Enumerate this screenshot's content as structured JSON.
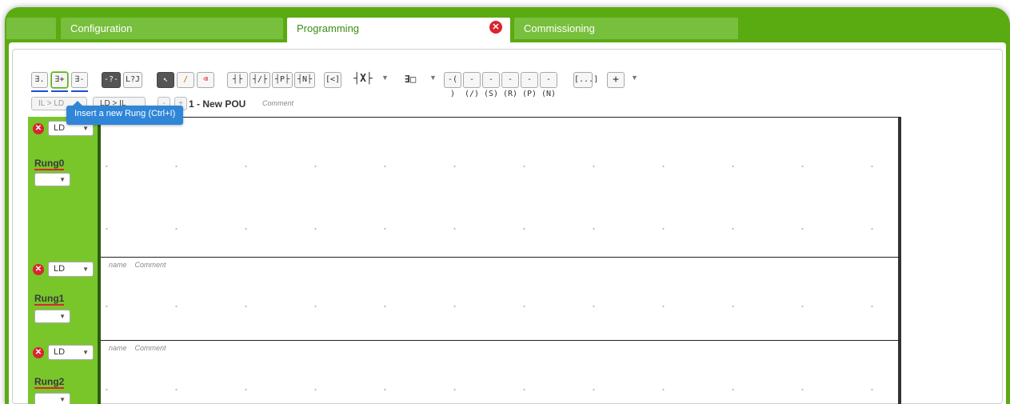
{
  "tabs": [
    {
      "label": "",
      "active": false
    },
    {
      "label": "Configuration",
      "active": false
    },
    {
      "label": "Programming",
      "active": true
    },
    {
      "label": "Commissioning",
      "active": false
    }
  ],
  "colors": {
    "accent": "#5aaa12",
    "active_tab_text": "#3b8c14",
    "close_red": "#d9252f",
    "tooltip": "#2f86d8"
  },
  "toolbar": {
    "buttons": [
      {
        "name": "insert-rung-before",
        "glyph": "∃."
      },
      {
        "name": "insert-rung-after",
        "glyph": "∃+"
      },
      {
        "name": "delete-rung",
        "glyph": "∃-"
      },
      {
        "name": "dark-left",
        "glyph": "-?-"
      },
      {
        "name": "branch",
        "glyph": "L?J"
      },
      {
        "name": "select",
        "glyph": "↖"
      },
      {
        "name": "draw",
        "glyph": "/"
      },
      {
        "name": "erase",
        "glyph": "⌫"
      },
      {
        "name": "contact-no",
        "glyph": "┤├"
      },
      {
        "name": "contact-nc",
        "glyph": "┤/├"
      },
      {
        "name": "contact-p",
        "glyph": "┤P├"
      },
      {
        "name": "contact-n",
        "glyph": "┤N├"
      },
      {
        "name": "compare",
        "glyph": "[<]"
      },
      {
        "name": "function-block",
        "glyph": "┤X├"
      },
      {
        "name": "block",
        "glyph": "∃□"
      },
      {
        "name": "coil",
        "glyph": "-( )"
      },
      {
        "name": "coil-not",
        "glyph": "-(/)"
      },
      {
        "name": "coil-set",
        "glyph": "-(S)"
      },
      {
        "name": "coil-reset",
        "glyph": "-(R)"
      },
      {
        "name": "coil-p",
        "glyph": "-(P)"
      },
      {
        "name": "coil-n",
        "glyph": "-(N)"
      },
      {
        "name": "jump",
        "glyph": "[...]"
      },
      {
        "name": "add-element",
        "glyph": "+"
      }
    ]
  },
  "secondary": {
    "il_to_ld": "IL > LD",
    "ld_to_il": "LD > IL",
    "minus": "-",
    "plus": "+",
    "pou_title": "1 - New POU",
    "pou_comment": "Comment"
  },
  "tooltip": "Insert a new Rung (Ctrl+I)",
  "rungs": [
    {
      "name": "Rung0",
      "language": "LD",
      "meta_name": "",
      "meta_comment": ""
    },
    {
      "name": "Rung1",
      "language": "LD",
      "meta_name": "name",
      "meta_comment": "Comment"
    },
    {
      "name": "Rung2",
      "language": "LD",
      "meta_name": "name",
      "meta_comment": "Comment"
    }
  ],
  "icons": {
    "tab_close": "close-circle-icon",
    "rung_delete": "close-circle-icon",
    "dropdown": "caret-down-icon"
  }
}
